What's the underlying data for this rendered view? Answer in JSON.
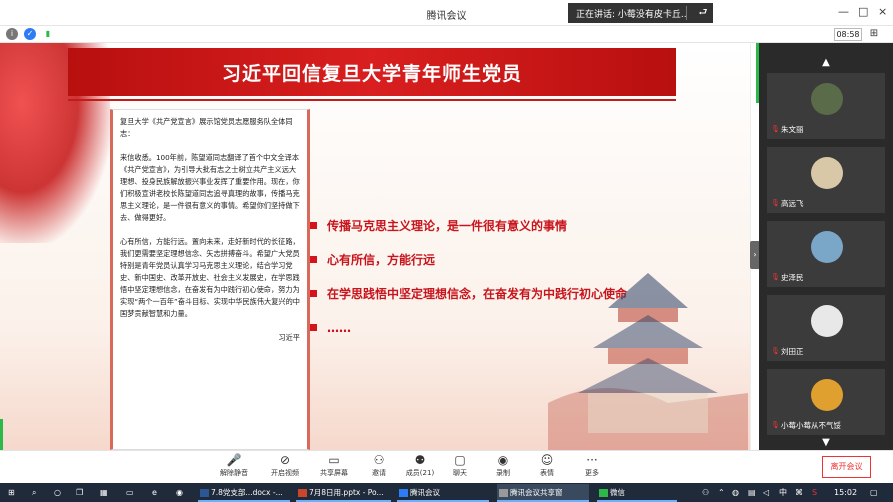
{
  "window": {
    "title": "腾讯会议",
    "speaking_prefix": "正在讲话:",
    "speaking_name": "小莓没有皮卡丘...",
    "controls": [
      "—",
      "□",
      "×"
    ]
  },
  "infobar": {
    "timer": "08:58"
  },
  "slide": {
    "title": "习近平回信复旦大学青年师生党员",
    "letter": {
      "salutation": "复旦大学《共产党宣言》展示馆党员志愿服务队全体同志：",
      "para1": "来信收悉。100年前，陈望道同志翻译了首个中文全译本《共产党宣言》，为引导大批有志之士树立共产主义远大理想、投身民族解放振兴事业发挥了重要作用。现在，你们积极宣讲老校长陈望道同志追寻真理的故事，传播马克思主义理论，是一件很有意义的事情。希望你们坚持做下去、做得更好。",
      "para2": "心有所信，方能行远。置向未来，走好新时代的长征路，我们更需要坚定理想信念、矢志拼搏奋斗。希望广大党员特别是青年党员认真学习马克思主义理论，结合学习党史、新中国史、改革开放史、社会主义发展史，在学思践悟中坚定理想信念，在奋发有为中践行初心使命，努力为实现“两个一百年”奋斗目标、实现中华民族伟大复兴的中国梦贡献智慧和力量。",
      "signature": "习近平"
    },
    "bullets": [
      "传播马克思主义理论，是一件很有意义的事情",
      "心有所信，方能行远",
      "在学思践悟中坚定理想信念，在奋发有为中践行初心使命",
      "……"
    ]
  },
  "participants": [
    {
      "name": "朱文丽",
      "avatar_color": "#5a6b4a"
    },
    {
      "name": "高远飞",
      "avatar_color": "#d8c8a8"
    },
    {
      "name": "史泽民",
      "avatar_color": "#7aa6c8"
    },
    {
      "name": "刘田正",
      "avatar_color": "#e8e8e8"
    },
    {
      "name": "小莓小莓从不气馁",
      "avatar_color": "#e0a030"
    }
  ],
  "toolbar": {
    "items": [
      {
        "label": "解除静音",
        "icon": "mic-muted-icon",
        "glyph": "🎤"
      },
      {
        "label": "开启视频",
        "icon": "camera-off-icon",
        "glyph": "⊘"
      },
      {
        "label": "共享屏幕",
        "icon": "share-screen-icon",
        "glyph": "▭"
      },
      {
        "label": "邀请",
        "icon": "invite-icon",
        "glyph": "⚇"
      },
      {
        "label": "成员(21)",
        "icon": "members-icon",
        "glyph": "⚉"
      },
      {
        "label": "聊天",
        "icon": "chat-icon",
        "glyph": "▢"
      },
      {
        "label": "录制",
        "icon": "record-icon",
        "glyph": "◉"
      },
      {
        "label": "表情",
        "icon": "emoji-icon",
        "glyph": "☺"
      },
      {
        "label": "更多",
        "icon": "more-icon",
        "glyph": "···"
      }
    ],
    "leave_label": "离开会议"
  },
  "taskbar": {
    "apps": [
      {
        "label": "7.8党支部...docx -...",
        "color": "#2b5797"
      },
      {
        "label": "7月8日用.pptx - Po...",
        "color": "#c8462a"
      },
      {
        "label": "腾讯会议",
        "color": "#2d7cf6"
      },
      {
        "label": "腾讯会议共享窗",
        "color": "#555555"
      },
      {
        "label": "微信",
        "color": "#2db84a"
      }
    ],
    "tray": {
      "ime": "中",
      "lang": "S",
      "time": "15:02"
    }
  },
  "colors": {
    "accent_red": "#c8141c",
    "panel_bg": "#2a2a2a",
    "taskbar_bg": "#1f2a3a"
  }
}
